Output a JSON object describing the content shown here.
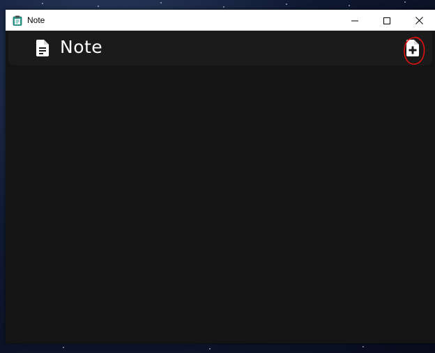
{
  "window": {
    "title": "Note",
    "icon": "clipboard-icon",
    "controls": [
      "minimize-icon",
      "maximize-icon",
      "close-icon"
    ]
  },
  "header": {
    "title": "Note",
    "title_icon": "document-icon",
    "new_note_icon": "file-plus-icon"
  },
  "colors": {
    "background": "#141414",
    "header_bg": "#1b1b1b",
    "text": "#ffffff",
    "annotation": "#e01010"
  }
}
